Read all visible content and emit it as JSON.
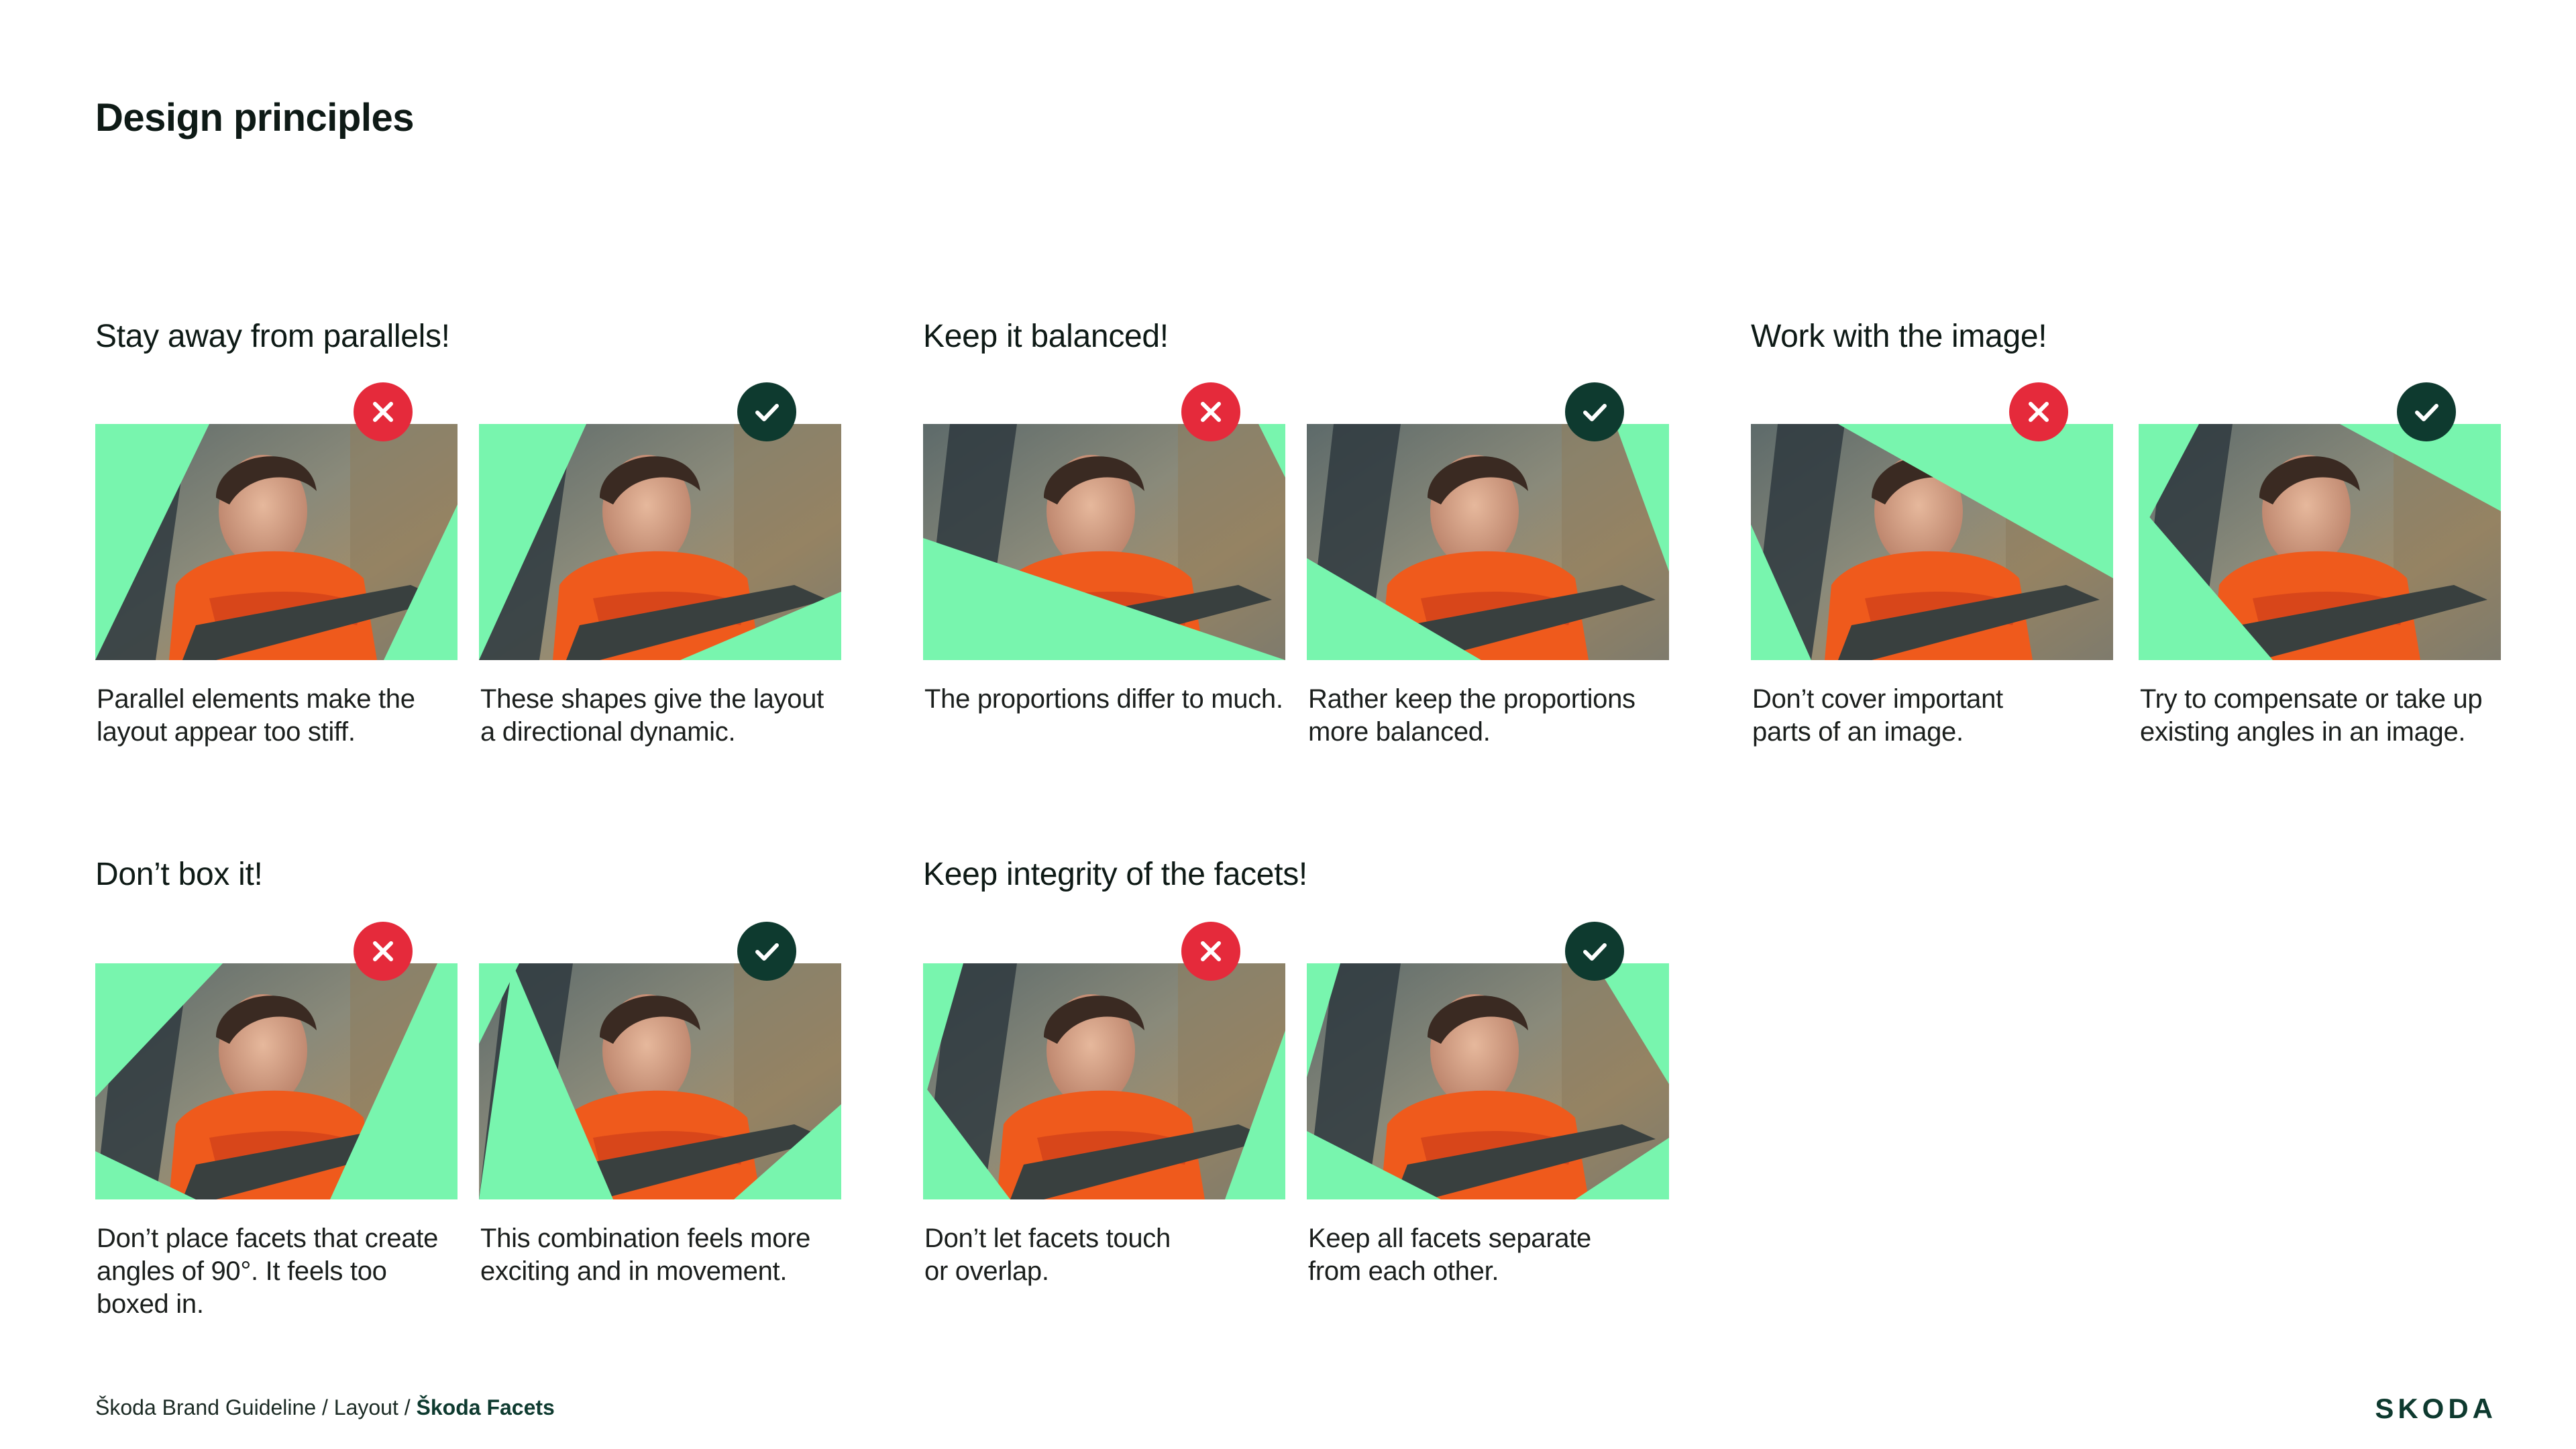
{
  "page_title": "Design principles",
  "colors": {
    "facet_green": "#78f5ae",
    "bad": "#e52a3b",
    "good": "#0e3a2f"
  },
  "sections": [
    {
      "title": "Stay away from parallels!",
      "cards": [
        {
          "verdict": "bad",
          "icon": "cross-icon",
          "caption": [
            "Parallel elements make the",
            "layout appear too stiff."
          ]
        },
        {
          "verdict": "good",
          "icon": "check-icon",
          "caption": [
            "These shapes give the layout",
            "a directional dynamic."
          ]
        }
      ]
    },
    {
      "title": "Keep it balanced!",
      "cards": [
        {
          "verdict": "bad",
          "icon": "cross-icon",
          "caption": [
            "The proportions differ to much."
          ]
        },
        {
          "verdict": "good",
          "icon": "check-icon",
          "caption": [
            "Rather keep the proportions",
            "more balanced."
          ]
        }
      ]
    },
    {
      "title": "Work with the image!",
      "cards": [
        {
          "verdict": "bad",
          "icon": "cross-icon",
          "caption": [
            "Don’t cover important",
            "parts of an image."
          ]
        },
        {
          "verdict": "good",
          "icon": "check-icon",
          "caption": [
            "Try to compensate or take up",
            "existing angles in an image."
          ]
        }
      ]
    },
    {
      "title": "Don’t box it!",
      "cards": [
        {
          "verdict": "bad",
          "icon": "cross-icon",
          "caption": [
            "Don’t place facets that create",
            "angles of 90°. It feels too",
            "boxed in."
          ]
        },
        {
          "verdict": "good",
          "icon": "check-icon",
          "caption": [
            "This combination feels more",
            "exciting and in movement."
          ]
        }
      ]
    },
    {
      "title": "Keep integrity of the facets!",
      "cards": [
        {
          "verdict": "bad",
          "icon": "cross-icon",
          "caption": [
            "Don’t let facets touch",
            "or overlap."
          ]
        },
        {
          "verdict": "good",
          "icon": "check-icon",
          "caption": [
            "Keep all facets separate",
            "from each other."
          ]
        }
      ]
    }
  ],
  "footer": {
    "path": "Škoda Brand Guideline / Layout / ",
    "current": "Škoda Facets"
  },
  "logo": "SKODA"
}
